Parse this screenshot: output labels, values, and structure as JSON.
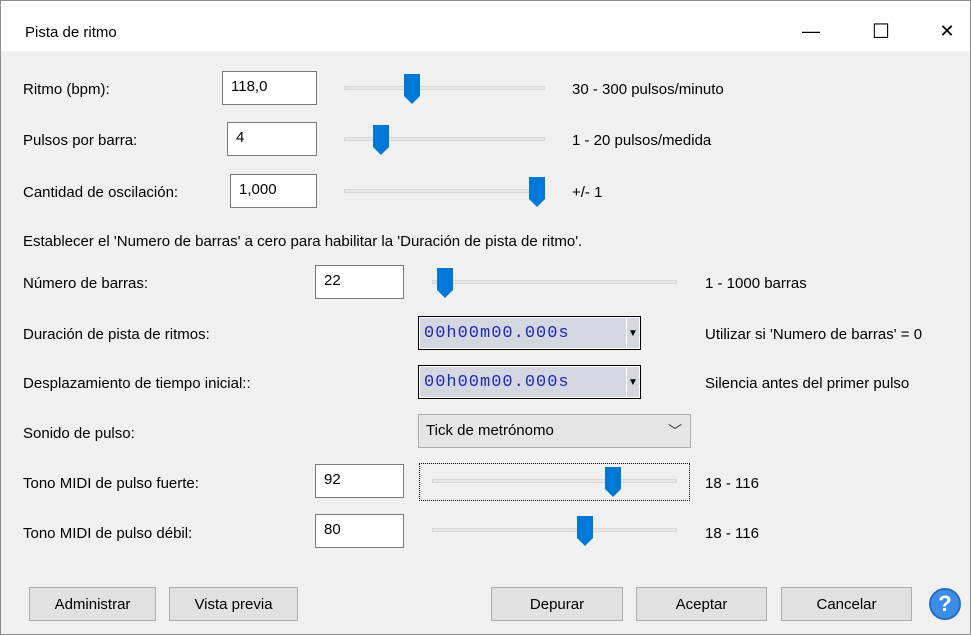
{
  "window": {
    "title": "Pista de ritmo",
    "minimize_glyph": "—",
    "maximize_glyph": "☐",
    "close_glyph": "✕"
  },
  "rows": {
    "tempo": {
      "label": "Ritmo (bpm):",
      "value": "118,0",
      "range": "30 - 300 pulsos/minuto",
      "slider_min": 30,
      "slider_max": 300,
      "slider_value": 118
    },
    "beats": {
      "label": "Pulsos por barra:",
      "value": "4",
      "range": "1 - 20 pulsos/medida",
      "slider_min": 1,
      "slider_max": 20,
      "slider_value": 4
    },
    "swing": {
      "label": "Cantidad de oscilación:",
      "value": "1,000",
      "range": "+/- 1",
      "slider_min": -1,
      "slider_max": 1,
      "slider_value": 1
    }
  },
  "info_text": "Establecer el 'Numero de barras' a cero para habilitar la 'Duración de pista de ritmo'.",
  "bars": {
    "label": "Número de barras:",
    "value": "22",
    "range": "1 - 1000 barras",
    "slider_min": 1,
    "slider_max": 1000,
    "slider_value": 22
  },
  "duration": {
    "label": "Duración de pista de ritmos:",
    "time": "00h00m00.000s",
    "hint": "Utilizar si 'Numero de barras' = 0"
  },
  "offset": {
    "label": "Desplazamiento de tiempo inicial::",
    "time": "00h00m00.000s",
    "hint": "Silencia antes del primer pulso"
  },
  "sound": {
    "label": "Sonido de pulso:",
    "selected": "Tick de metrónomo"
  },
  "midi_strong": {
    "label": "Tono MIDI de pulso fuerte:",
    "value": "92",
    "range": "18 - 116",
    "slider_min": 18,
    "slider_max": 116,
    "slider_value": 92
  },
  "midi_weak": {
    "label": "Tono MIDI de pulso débil:",
    "value": "80",
    "range": "18 - 116",
    "slider_min": 18,
    "slider_max": 116,
    "slider_value": 80
  },
  "buttons": {
    "manage": "Administrar",
    "preview": "Vista previa",
    "debug": "Depurar",
    "ok": "Aceptar",
    "cancel": "Cancelar",
    "help": "?"
  },
  "colors": {
    "accent": "#0078d7",
    "time_digits": "#1e2bb0"
  },
  "icons": {
    "help": "question-mark-icon",
    "dropdown": "chevron-down-icon"
  }
}
